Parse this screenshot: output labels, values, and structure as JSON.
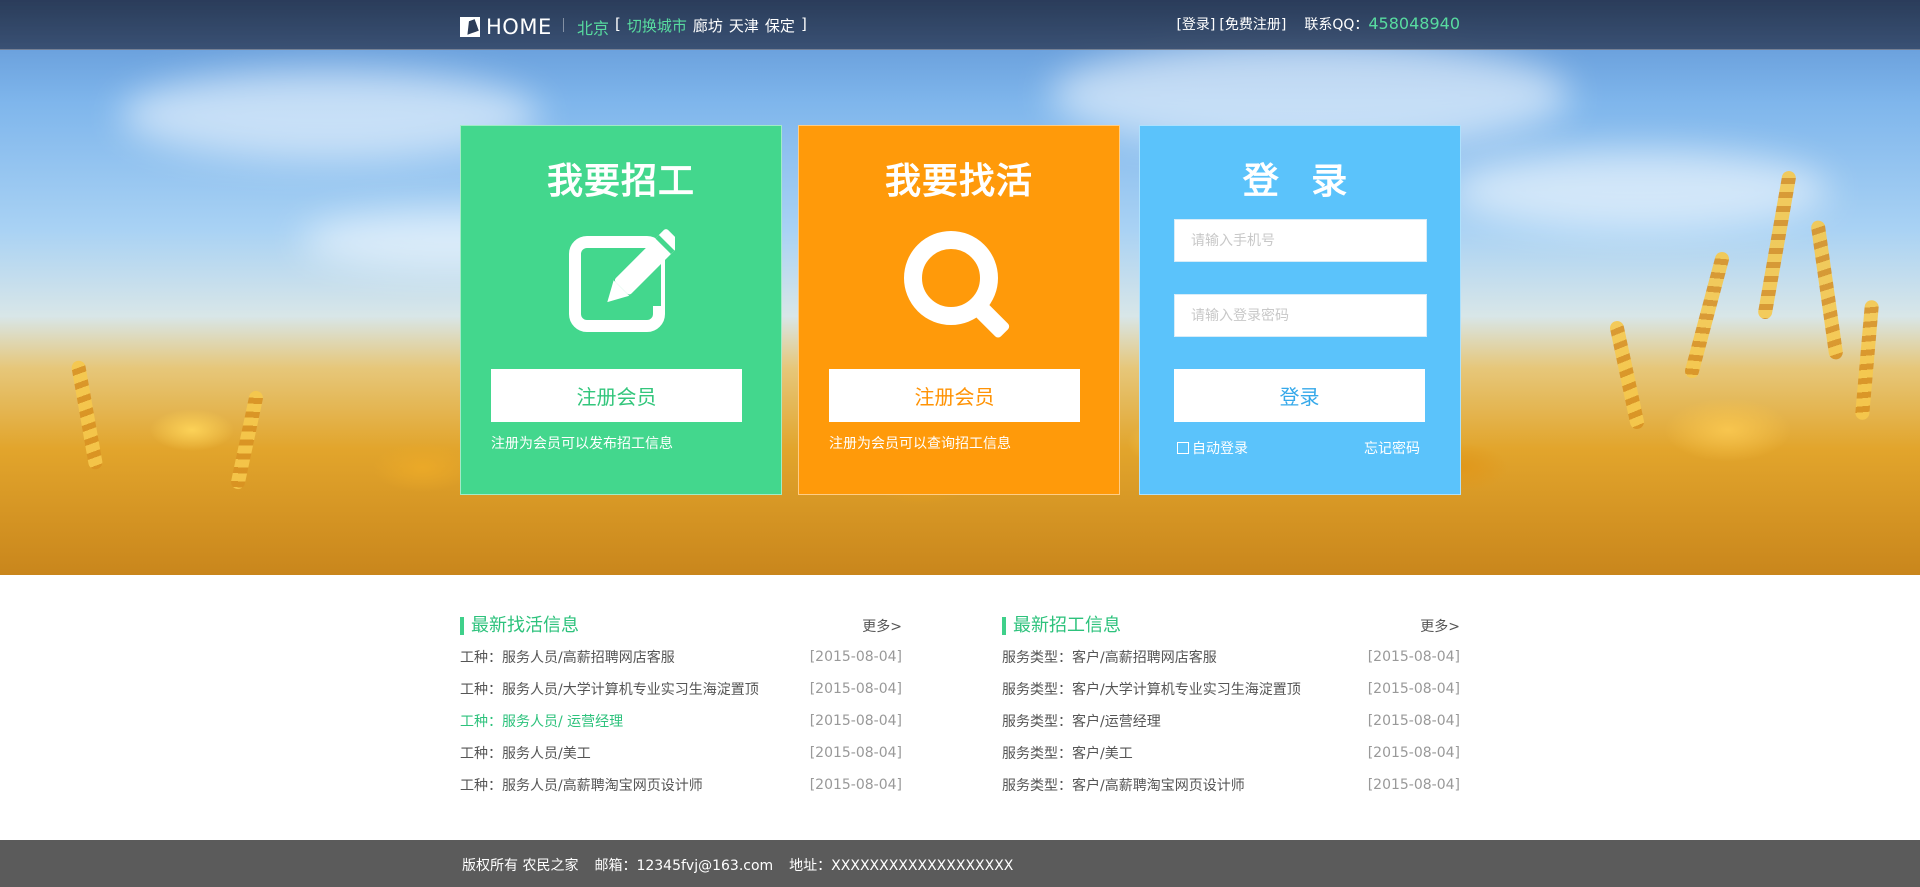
{
  "header": {
    "logo_text": "HOME",
    "city_current": "北京",
    "bracket_open": "[",
    "city_switch": "切换城市",
    "cities": [
      "廊坊",
      "天津",
      "保定"
    ],
    "bracket_close": "]",
    "login_link": "[登录]",
    "register_link": "[免费注册]",
    "qq_label": "联系QQ：",
    "qq_number": "458048940"
  },
  "cards": {
    "employer": {
      "title": "我要招工",
      "button": "注册会员",
      "note": "注册为会员可以发布招工信息",
      "icon": "edit-icon",
      "color": "#43d78d"
    },
    "worker": {
      "title": "我要找活",
      "button": "注册会员",
      "note": "注册为会员可以查询招工信息",
      "icon": "search-icon",
      "color": "#ff9a0a"
    },
    "login": {
      "title": "登 录",
      "phone_placeholder": "请输入手机号",
      "password_placeholder": "请输入登录密码",
      "button": "登录",
      "auto_login": "自动登录",
      "forgot": "忘记密码",
      "color": "#5bc3fb"
    }
  },
  "lists": {
    "job_seek": {
      "title": "最新找活信息",
      "more": "更多>",
      "items": [
        {
          "text": "工种：服务人员/高薪招聘网店客服",
          "date": "[2015-08-04]"
        },
        {
          "text": "工种：服务人员/大学计算机专业实习生海淀置顶",
          "date": "[2015-08-04]"
        },
        {
          "text": "工种：服务人员/ 运营经理",
          "date": "[2015-08-04]"
        },
        {
          "text": "工种：服务人员/美工",
          "date": "[2015-08-04]"
        },
        {
          "text": "工种：服务人员/高薪聘淘宝网页设计师",
          "date": "[2015-08-04]"
        }
      ]
    },
    "job_hire": {
      "title": "最新招工信息",
      "more": "更多>",
      "items": [
        {
          "text": "服务类型：客户/高薪招聘网店客服",
          "date": "[2015-08-04]"
        },
        {
          "text": "服务类型：客户/大学计算机专业实习生海淀置顶",
          "date": "[2015-08-04]"
        },
        {
          "text": "服务类型：客户/运营经理",
          "date": "[2015-08-04]"
        },
        {
          "text": "服务类型：客户/美工",
          "date": "[2015-08-04]"
        },
        {
          "text": "服务类型：客户/高薪聘淘宝网页设计师",
          "date": "[2015-08-04]"
        }
      ]
    }
  },
  "footer": {
    "copyright": "版权所有 农民之家",
    "email": "邮箱：12345fvj@163.com",
    "address": "地址：XXXXXXXXXXXXXXXXXXX"
  },
  "colors": {
    "accent_green": "#2dc27c",
    "accent_orange": "#ff9305",
    "accent_blue": "#36a9ea",
    "footer_bg": "#5b5b5b"
  }
}
